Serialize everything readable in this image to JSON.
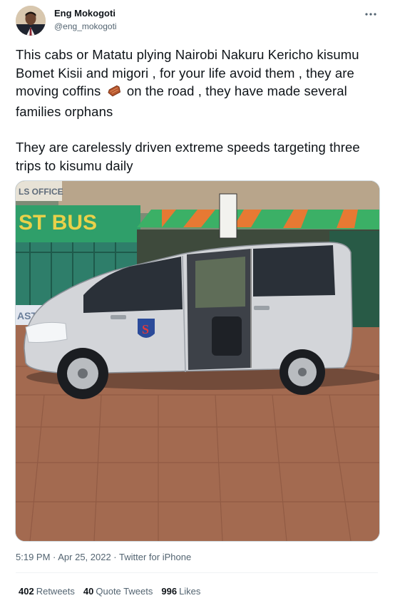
{
  "user": {
    "display_name": "Eng Mokogoti",
    "handle": "@eng_mokogoti",
    "avatar_icon": "user-avatar-photo"
  },
  "tweet": {
    "text_p1_before_emoji": "This cabs or Matatu plying Nairobi Nakuru Kericho kisumu Bomet Kisii and migori  , for your life avoid them , they are moving coffins",
    "emoji_icon": "coffin-emoji",
    "text_p1_after_emoji": "on the road , they have made several families orphans",
    "text_p2": "They are carelessly driven extreme speeds targeting three trips to kisumu daily",
    "media": {
      "sign_office": "LS OFFICE",
      "sign_bus": "ST BUS",
      "sign_left_lower": "AST"
    },
    "timestamp": "5:19 PM · Apr 25, 2022 · ",
    "source": "Twitter for iPhone"
  },
  "stats": {
    "retweets_count": "402",
    "retweets_label": "Retweets",
    "quotes_count": "40",
    "quotes_label": "Quote Tweets",
    "likes_count": "996",
    "likes_label": "Likes"
  },
  "colors": {
    "text": "#0f1419",
    "secondary": "#536471",
    "divider": "#eff3f4"
  }
}
